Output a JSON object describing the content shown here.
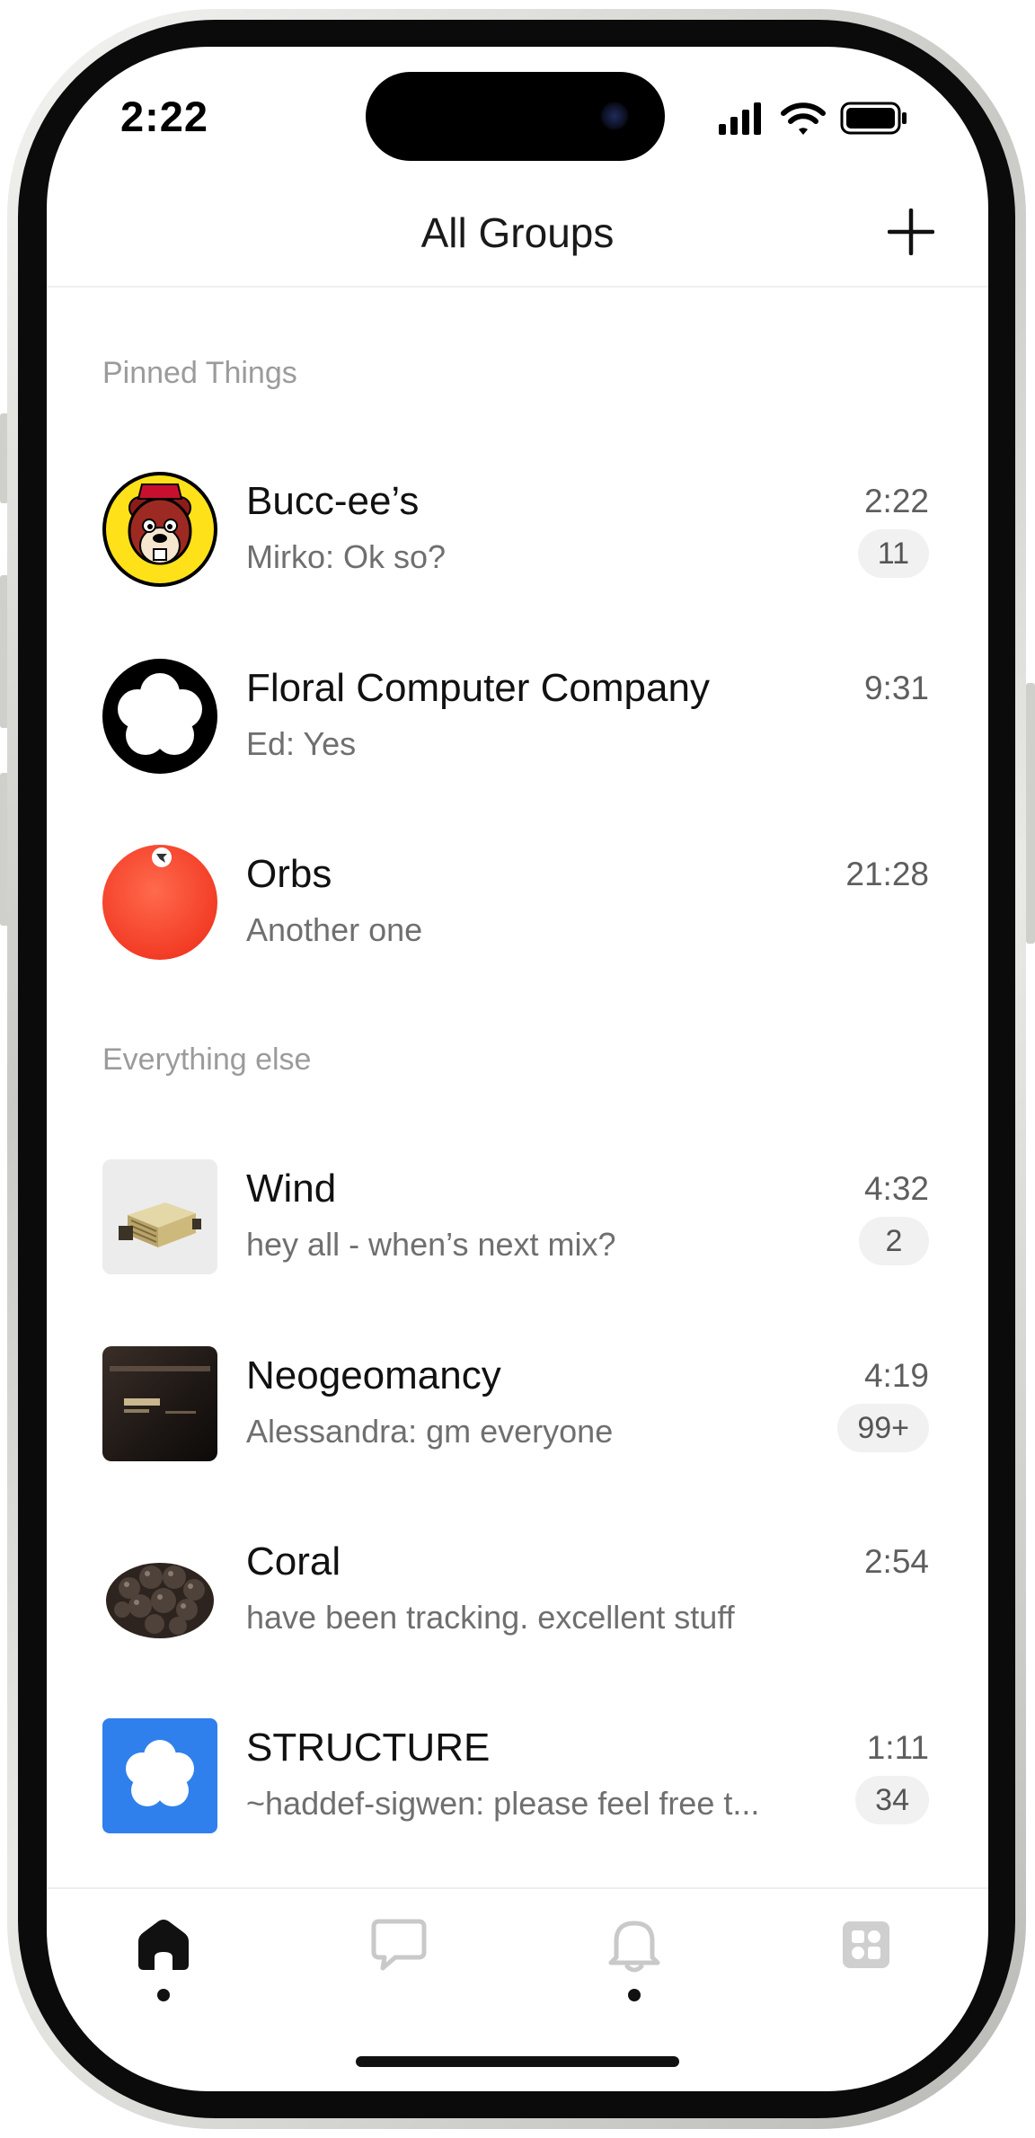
{
  "status_bar": {
    "time": "2:22"
  },
  "header": {
    "title": "All Groups",
    "add_icon": "plus-icon"
  },
  "sections": [
    {
      "label": "Pinned Things",
      "groups": [
        {
          "name": "Bucc-ee’s",
          "preview": "Mirko: Ok so?",
          "time": "2:22",
          "unread": "11",
          "avatar": "beaver-logo"
        },
        {
          "name": "Floral Computer Company",
          "preview": "Ed: Yes",
          "time": "9:31",
          "unread": "",
          "avatar": "flower-ring-logo"
        },
        {
          "name": "Orbs",
          "preview": "Another one",
          "time": "21:28",
          "unread": "",
          "avatar": "red-orb"
        }
      ]
    },
    {
      "label": "Everything else",
      "groups": [
        {
          "name": "Wind",
          "preview": "hey all - when’s next mix?",
          "time": "4:32",
          "unread": "2",
          "avatar": "gold-device-photo"
        },
        {
          "name": "Neogeomancy",
          "preview": "Alessandra: gm everyone",
          "time": "4:19",
          "unread": "99+",
          "avatar": "neo-geo-console-photo"
        },
        {
          "name": "Coral",
          "preview": "have been tracking. excellent stuff",
          "time": "2:54",
          "unread": "",
          "avatar": "dark-coral-object-photo"
        },
        {
          "name": "STRUCTURE",
          "preview": "~haddef-sigwen: please feel free t...",
          "time": "1:11",
          "unread": "34",
          "avatar": "blue-flower-logo"
        }
      ]
    }
  ],
  "tab_bar": {
    "tabs": [
      {
        "id": "home",
        "icon": "home-icon",
        "active": true
      },
      {
        "id": "messages",
        "icon": "chat-bubble-icon",
        "active": false
      },
      {
        "id": "notifications",
        "icon": "bell-icon",
        "active": false
      },
      {
        "id": "apps",
        "icon": "grid-icon",
        "active": false
      }
    ]
  },
  "colors": {
    "badge_bg": "#f1f1f1",
    "muted_text": "#9b9b9b",
    "orb_red": "#ff4a33",
    "structure_blue": "#2f80ed",
    "buccees_yellow": "#ffe11a"
  }
}
